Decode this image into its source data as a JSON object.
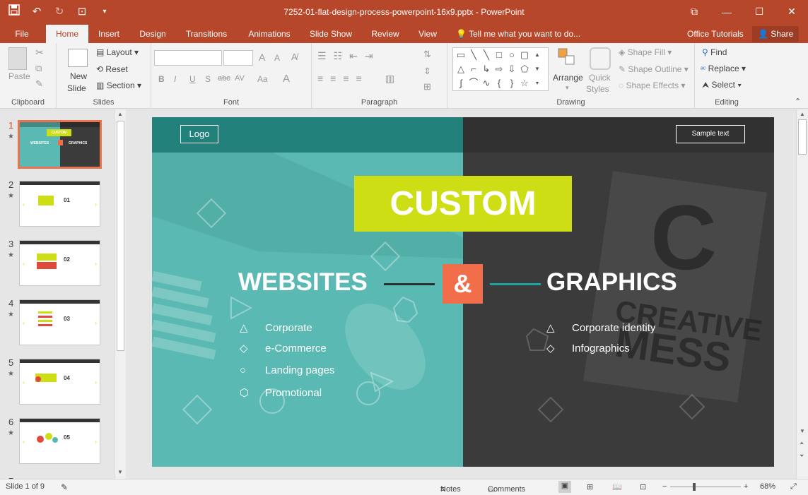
{
  "window": {
    "title": "7252-01-flat-design-process-powerpoint-16x9.pptx - PowerPoint",
    "controls": [
      "restore-ribbon-icon",
      "minimize-icon",
      "maximize-icon",
      "close-icon"
    ]
  },
  "qat": {
    "icons": [
      "save-icon",
      "undo-icon",
      "redo-icon",
      "start-slideshow-icon",
      "customize-qat-icon"
    ]
  },
  "tabs": {
    "file": "File",
    "home": "Home",
    "insert": "Insert",
    "design": "Design",
    "transitions": "Transitions",
    "animations": "Animations",
    "slideshow": "Slide Show",
    "review": "Review",
    "view": "View",
    "tellme": "Tell me what you want to do...",
    "office_tutorials": "Office Tutorials",
    "share": "Share"
  },
  "ribbon": {
    "clipboard": {
      "label": "Clipboard",
      "paste": "Paste"
    },
    "slides": {
      "label": "Slides",
      "new_slide": "New",
      "new_slide2": "Slide",
      "layout": "Layout",
      "reset": "Reset",
      "section": "Section"
    },
    "font": {
      "label": "Font",
      "bold": "B",
      "italic": "I",
      "underline": "U",
      "shadow": "S",
      "strike": "abc",
      "spacing": "AV",
      "case": "Aa",
      "color": "A",
      "grow": "A",
      "shrink": "A"
    },
    "paragraph": {
      "label": "Paragraph"
    },
    "drawing": {
      "label": "Drawing",
      "arrange": "Arrange",
      "quick_styles": "Quick",
      "quick_styles2": "Styles",
      "shape_fill": "Shape Fill",
      "shape_outline": "Shape Outline",
      "shape_effects": "Shape Effects"
    },
    "editing": {
      "label": "Editing",
      "find": "Find",
      "replace": "Replace",
      "select": "Select"
    }
  },
  "thumbnails": [
    {
      "num": "1",
      "label": ""
    },
    {
      "num": "2",
      "label": "01"
    },
    {
      "num": "3",
      "label": "02"
    },
    {
      "num": "4",
      "label": "03"
    },
    {
      "num": "5",
      "label": "04"
    },
    {
      "num": "6",
      "label": "05"
    },
    {
      "num": "7",
      "label": ""
    }
  ],
  "thumb1": {
    "custom": "CUSTOM",
    "websites": "WEBSITES",
    "graphics": "GRAPHICS"
  },
  "slide": {
    "logo": "Logo",
    "sample_text": "Sample text",
    "custom": "CUSTOM",
    "websites": "WEBSITES",
    "amp": "&",
    "graphics": "GRAPHICS",
    "left_items": [
      "Corporate",
      "e-Commerce",
      "Landing pages",
      "Promotional"
    ],
    "right_items": [
      "Corporate identity",
      "Infographics"
    ],
    "bg_text_c": "C",
    "bg_text_creative": "CREATIVE",
    "bg_text_mess": "MESS",
    "colors": {
      "teal": "#5ab9b2",
      "dark": "#3b3b3b",
      "lime": "#cede14",
      "orange": "#f26d4a"
    }
  },
  "status": {
    "slide_of": "Slide 1 of 9",
    "notes": "Notes",
    "comments": "Comments",
    "zoom": "68%"
  }
}
